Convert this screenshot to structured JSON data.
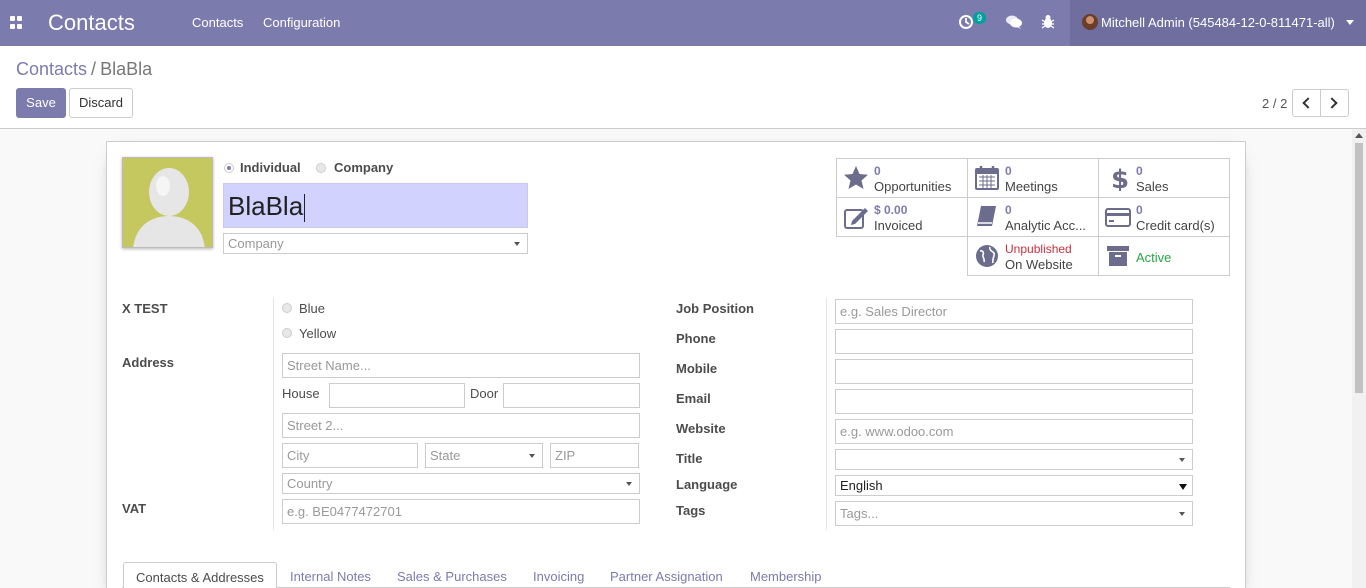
{
  "navbar": {
    "app_name": "Contacts",
    "menu": [
      "Contacts",
      "Configuration"
    ],
    "activity_count": "9",
    "user": "Mitchell Admin (545484-12-0-811471-all)",
    "color": "#7c7bad",
    "icons": [
      "apps-grid-icon",
      "clock-icon",
      "chat-icon",
      "bug-icon"
    ]
  },
  "control_panel": {
    "breadcrumb_root": "Contacts",
    "breadcrumb_sep": "/",
    "breadcrumb_current": "BlaBla",
    "save_label": "Save",
    "discard_label": "Discard",
    "pager": "2 / 2"
  },
  "form": {
    "type_options": [
      "Individual",
      "Company"
    ],
    "type_selected": "Individual",
    "name": "BlaBla",
    "company_placeholder": "Company",
    "x_test_label": "X TEST",
    "x_test_options": [
      "Blue",
      "Yellow"
    ],
    "address_label": "Address",
    "street_placeholder": "Street Name...",
    "house_label": "House",
    "door_label": "Door",
    "street2_placeholder": "Street 2...",
    "city_placeholder": "City",
    "state_placeholder": "State",
    "zip_placeholder": "ZIP",
    "country_placeholder": "Country",
    "vat_label": "VAT",
    "vat_placeholder": "e.g. BE0477472701",
    "job_position_label": "Job Position",
    "job_position_placeholder": "e.g. Sales Director",
    "phone_label": "Phone",
    "mobile_label": "Mobile",
    "email_label": "Email",
    "website_label": "Website",
    "website_placeholder": "e.g. www.odoo.com",
    "title_label": "Title",
    "language_label": "Language",
    "language_value": "English",
    "tags_label": "Tags",
    "tags_placeholder": "Tags..."
  },
  "smart_buttons": [
    {
      "value": "0",
      "label": "Opportunities",
      "icon": "star-icon"
    },
    {
      "value": "0",
      "label": "Meetings",
      "icon": "calendar-icon"
    },
    {
      "value": "0",
      "label": "Sales",
      "icon": "dollar-icon"
    },
    {
      "value": "$ 0.00",
      "label": "Invoiced",
      "icon": "edit-icon"
    },
    {
      "value": "0",
      "label": "Analytic Acc...",
      "icon": "book-icon"
    },
    {
      "value": "0",
      "label": "Credit card(s)",
      "icon": "credit-card-icon"
    },
    {
      "value": "Unpublished",
      "label": "On Website",
      "icon": "globe-icon",
      "value_color": "#c9303e"
    },
    {
      "value": "Active",
      "label": "",
      "icon": "archive-icon",
      "value_color": "#28a745"
    }
  ],
  "tabs": [
    "Contacts & Addresses",
    "Internal Notes",
    "Sales & Purchases",
    "Invoicing",
    "Partner Assignation",
    "Membership"
  ]
}
